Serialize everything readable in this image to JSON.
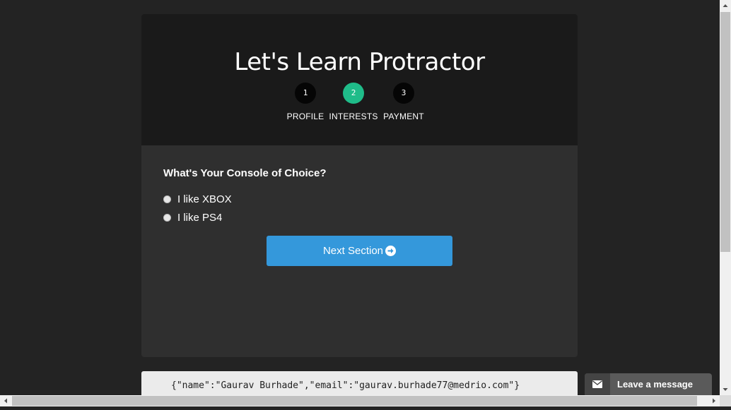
{
  "header": {
    "title": "Let's Learn Protractor"
  },
  "steps": [
    {
      "number": "1",
      "label": "PROFILE",
      "active": false
    },
    {
      "number": "2",
      "label": "INTERESTS",
      "active": true
    },
    {
      "number": "3",
      "label": "PAYMENT",
      "active": false
    }
  ],
  "form": {
    "question": "What's Your Console of Choice?",
    "options": [
      {
        "label": "I like XBOX",
        "checked": false
      },
      {
        "label": "I like PS4",
        "checked": false
      }
    ],
    "next_label": "Next Section"
  },
  "json_output": "{\"name\":\"Gaurav Burhade\",\"email\":\"gaurav.burhade77@medrio.com\"}",
  "chat": {
    "label": "Leave a message",
    "icon": "envelope-icon"
  },
  "colors": {
    "active_step": "#1fbc89",
    "button": "#3498db",
    "header_bg": "#1a1a1a",
    "body_bg": "#2f2f2f"
  },
  "scrollbars": {
    "vertical_thumb_fraction": 0.61,
    "horizontal_thumb_fraction": 0.97
  }
}
